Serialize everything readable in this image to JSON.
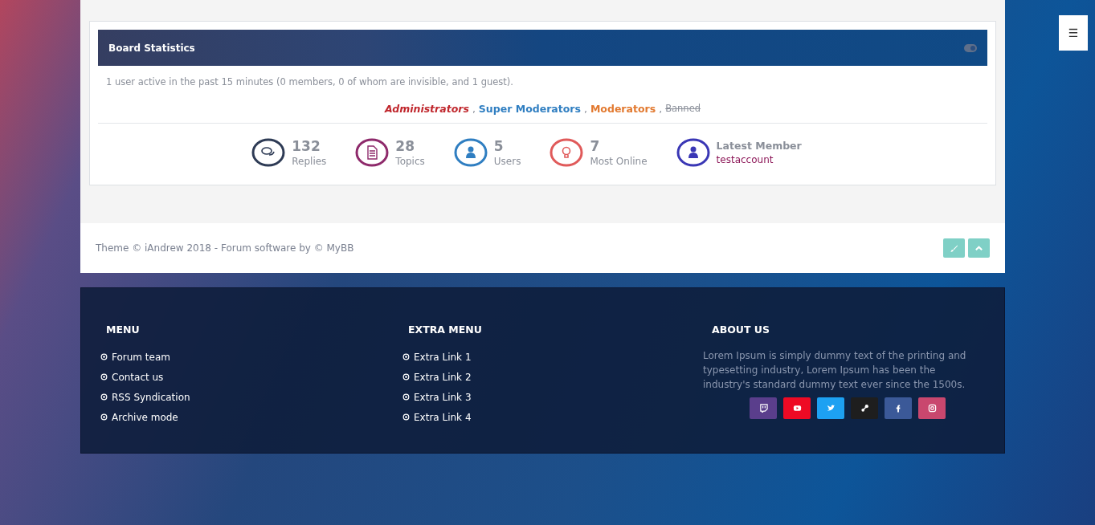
{
  "menu_button": {
    "label": "☰"
  },
  "board_statistics": {
    "title": "Board Statistics",
    "collapse_toggle": {
      "on": true
    },
    "online_text": "1 user active in the past 15 minutes (0 members, 0 of whom are invisible, and 1 guest).",
    "separator": ",",
    "groups": [
      {
        "label": "Administrators",
        "kind": "admin",
        "color": "#c0272d"
      },
      {
        "label": "Super Moderators",
        "kind": "normal",
        "color": "#2f7ec1"
      },
      {
        "label": "Moderators",
        "kind": "normal",
        "color": "#e2792f"
      },
      {
        "label": "Banned",
        "kind": "banned",
        "color": "#8a8f99"
      }
    ],
    "stats": [
      {
        "value": "132",
        "label": "Replies",
        "kind": "replies",
        "color": "#2e3b55"
      },
      {
        "value": "28",
        "label": "Topics",
        "kind": "topics",
        "color": "#8e2a6b"
      },
      {
        "value": "5",
        "label": "Users",
        "kind": "users",
        "color": "#2f7ec1"
      },
      {
        "value": "7",
        "label": "Most Online",
        "kind": "online",
        "color": "#e05a5a"
      },
      {
        "value": "Latest Member",
        "label": "testaccount",
        "kind": "latest",
        "color": "#3a37b5"
      }
    ]
  },
  "copyright": "Theme © iAndrew 2018 - Forum software by © MyBB",
  "footer_buttons": [
    {
      "kind": "brush"
    },
    {
      "kind": "up"
    }
  ],
  "footer": {
    "columns": [
      {
        "title": "MENU",
        "links": [
          "Forum team",
          "Contact us",
          "RSS Syndication",
          "Archive mode"
        ]
      },
      {
        "title": "EXTRA MENU",
        "links": [
          "Extra Link 1",
          "Extra Link 2",
          "Extra Link 3",
          "Extra Link 4"
        ]
      }
    ],
    "about": {
      "title": "ABOUT US",
      "text": "Lorem Ipsum is simply dummy text of the printing and typesetting industry, Lorem Ipsum has been the industry's standard dummy text ever since the 1500s."
    },
    "social": [
      {
        "kind": "twitch",
        "color": "#5a3e8c"
      },
      {
        "kind": "youtube",
        "color": "#ee0a24"
      },
      {
        "kind": "twitter",
        "color": "#1da1f2"
      },
      {
        "kind": "steam",
        "color": "#1e1e1e"
      },
      {
        "kind": "facebook",
        "color": "#3b5998"
      },
      {
        "kind": "instagram",
        "color": "#c9476e"
      }
    ]
  }
}
